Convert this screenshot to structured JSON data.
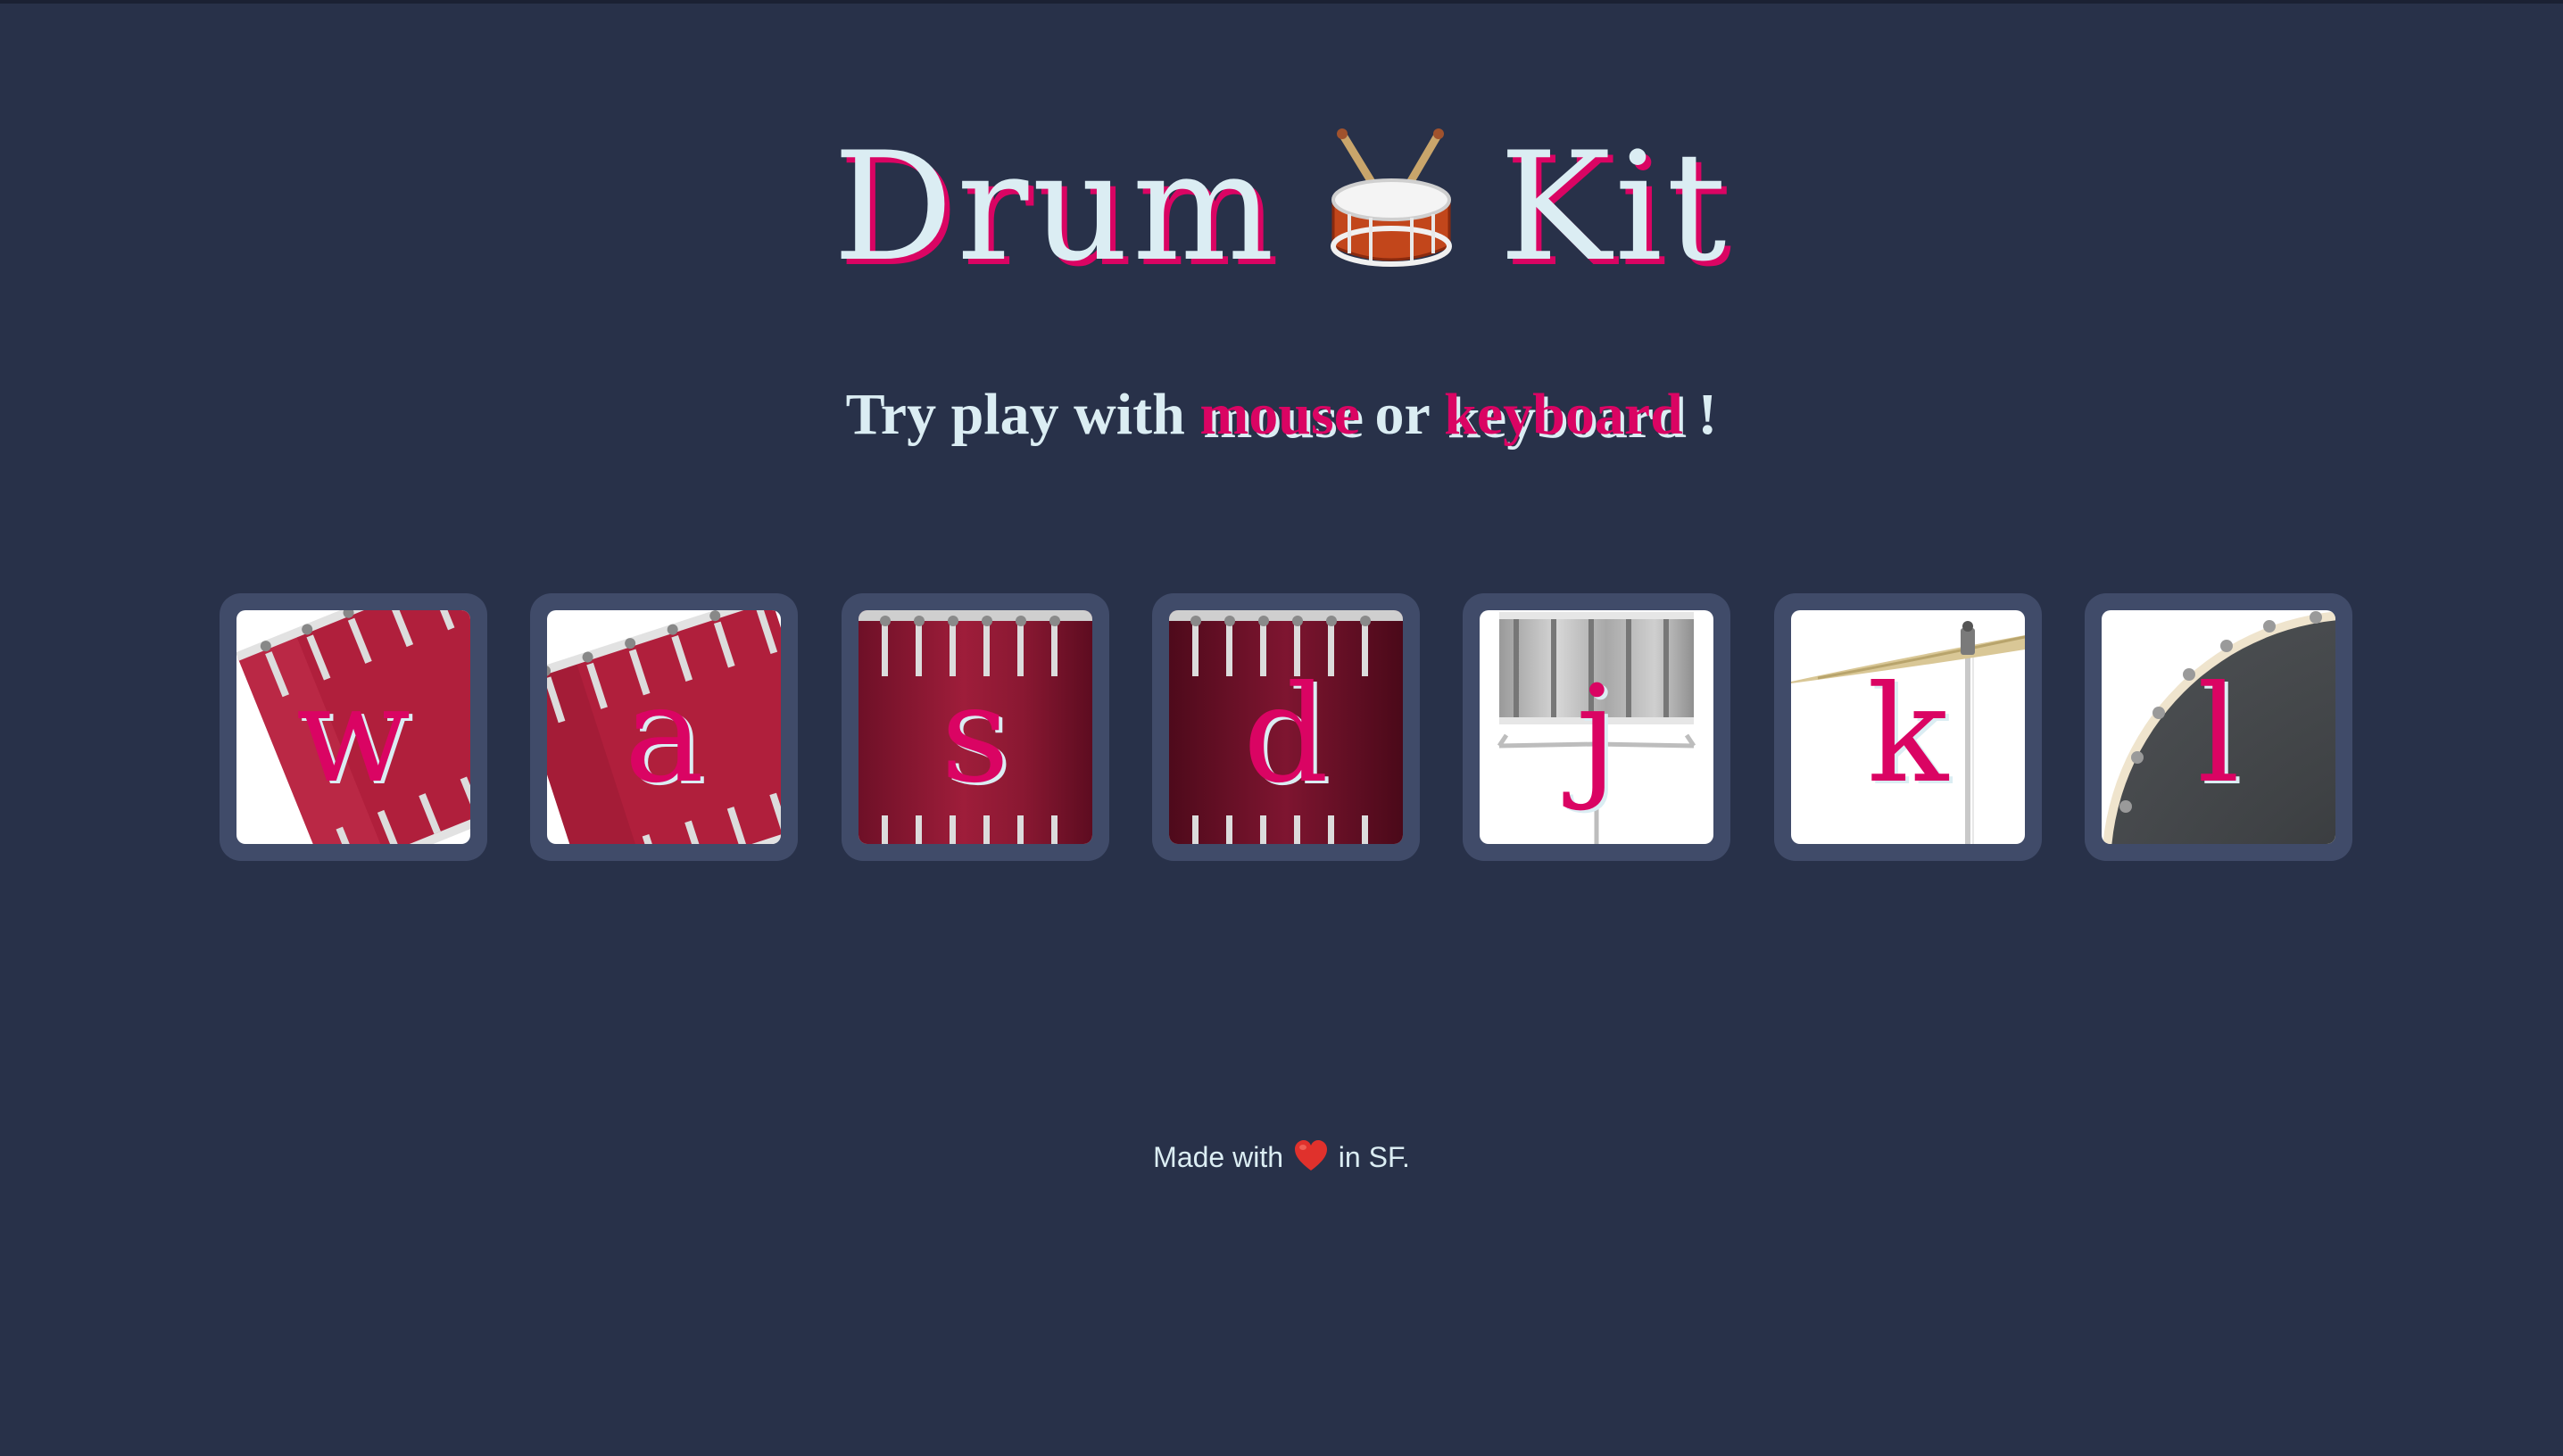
{
  "page": {
    "title_left": "Drum",
    "title_right": "Kit",
    "title_icon": "drum-emoji",
    "subtitle": {
      "prefix": "Try play with",
      "mouse": "mouse",
      "or": "or",
      "keyboard": "keyboard",
      "suffix": "!"
    }
  },
  "keys": [
    {
      "letter": "w",
      "sound": "tom-1",
      "image": "red-tom-tilted"
    },
    {
      "letter": "a",
      "sound": "tom-2",
      "image": "red-tom-tilted"
    },
    {
      "letter": "s",
      "sound": "tom-3",
      "image": "red-floor-tom"
    },
    {
      "letter": "d",
      "sound": "tom-4",
      "image": "red-floor-tom"
    },
    {
      "letter": "j",
      "sound": "snare",
      "image": "silver-snare"
    },
    {
      "letter": "k",
      "sound": "crash",
      "image": "cymbal"
    },
    {
      "letter": "l",
      "sound": "kick-bass",
      "image": "bass-drum"
    }
  ],
  "footer": {
    "prefix": "Made with",
    "icon": "heart-emoji",
    "suffix": "in SF."
  },
  "colors": {
    "background": "#283149",
    "key_frame": "#404b69",
    "text_light": "#dbedf3",
    "accent": "#da0463"
  }
}
